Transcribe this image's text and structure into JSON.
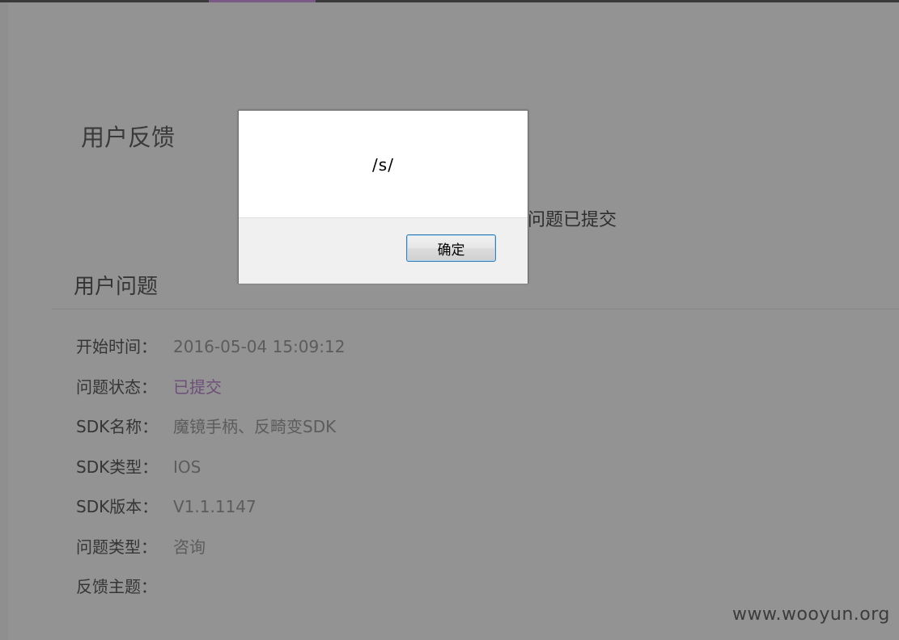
{
  "page": {
    "title": "用户反馈",
    "submitted_message": "问题已提交",
    "section_title": "用户问题"
  },
  "fields": [
    {
      "label": "开始时间：",
      "value": "2016-05-04 15:09:12"
    },
    {
      "label": "问题状态：",
      "value": "已提交"
    },
    {
      "label": "SDK名称：",
      "value": "魔镜手柄、反畸变SDK"
    },
    {
      "label": "SDK类型：",
      "value": "IOS"
    },
    {
      "label": "SDK版本：",
      "value": "V1.1.1147"
    },
    {
      "label": "问题类型：",
      "value": "咨询"
    },
    {
      "label": "反馈主题：",
      "value": ""
    }
  ],
  "dialog": {
    "message": "/s/",
    "ok_label": "确定"
  },
  "watermark": "www.wooyun.org",
  "colors": {
    "status_accent": "#6d4f78",
    "active_tab": "#7a5a86",
    "overlay_gray": "#939393"
  }
}
